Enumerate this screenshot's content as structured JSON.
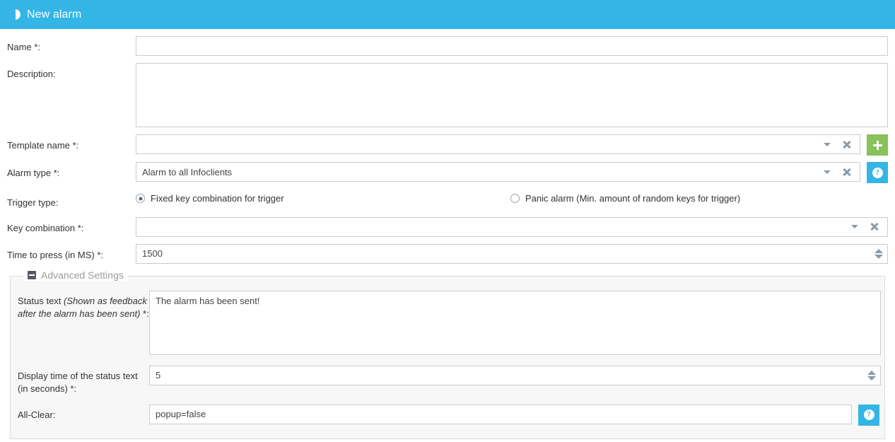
{
  "header": {
    "title": "New alarm",
    "icon": "contrast-circle-icon",
    "background": "#33b5e5"
  },
  "form": {
    "name": {
      "label": "Name *:",
      "value": "",
      "placeholder": ""
    },
    "description": {
      "label": "Description:",
      "value": "",
      "placeholder": ""
    },
    "template_name": {
      "label": "Template name *:",
      "value": "",
      "add_button_icon": "plus-icon",
      "caret_icon": "chevron-down-icon",
      "clear_icon": "clear-x-icon"
    },
    "alarm_type": {
      "label": "Alarm type *:",
      "value": "Alarm to all Infoclients",
      "help_button_icon": "question-mark-icon",
      "caret_icon": "chevron-down-icon",
      "clear_icon": "clear-x-icon"
    },
    "trigger_type": {
      "label": "Trigger type:",
      "options": [
        {
          "label": "Fixed key combination for trigger",
          "selected": true
        },
        {
          "label": "Panic alarm (Min. amount of random keys for trigger)",
          "selected": false
        }
      ]
    },
    "key_combination": {
      "label": "Key combination *:",
      "value": "",
      "caret_icon": "chevron-down-icon",
      "clear_icon": "clear-x-icon"
    },
    "time_to_press": {
      "label": "Time to press (in MS) *:",
      "value": "1500",
      "spinner_icon": "spinner-up-down-icon"
    }
  },
  "advanced": {
    "legend": "Advanced Settings",
    "collapse_icon": "collapse-minus-icon",
    "status_text": {
      "label_main": "Status text ",
      "label_italic": "(Shown as feedback after the alarm has been sent)",
      "label_suffix": " *:",
      "value": "The alarm has been sent!"
    },
    "display_time": {
      "label": "Display time of the status text (in seconds) *:",
      "value": "5",
      "spinner_icon": "spinner-up-down-icon"
    },
    "all_clear": {
      "label": "All-Clear:",
      "value": "popup=false",
      "help_button_icon": "question-mark-icon"
    }
  },
  "colors": {
    "accent_blue": "#33b5e5",
    "add_green": "#87c25a",
    "border_gray": "#cccccc",
    "panel_bg": "#f7f7f7"
  }
}
